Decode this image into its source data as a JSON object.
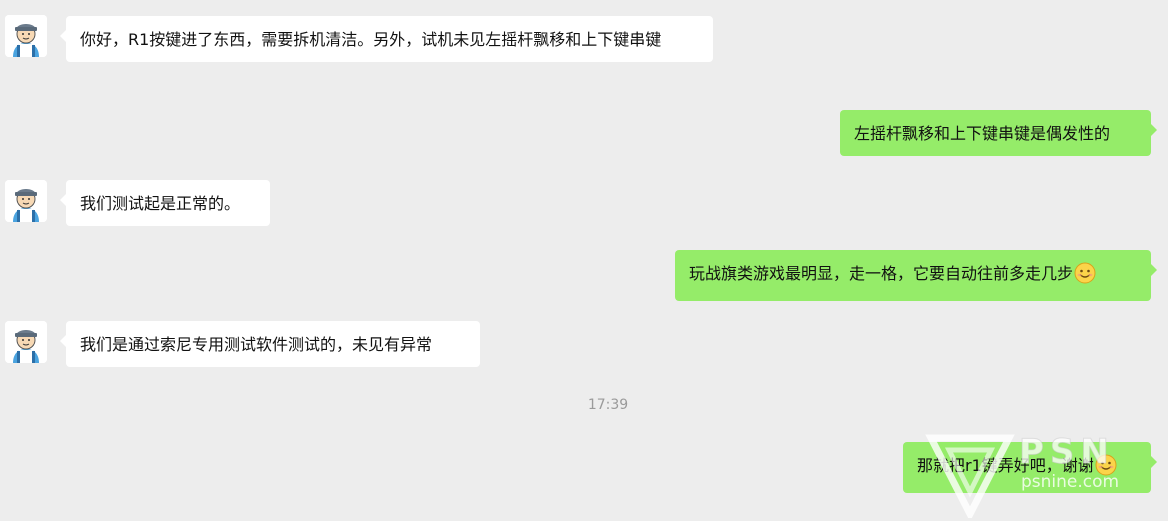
{
  "chat": {
    "messages": [
      {
        "side": "left",
        "text": "你好，R1按键进了东西，需要拆机清洁。另外，试机未见左摇杆飘移和上下键串键"
      },
      {
        "side": "right",
        "text": "左摇杆飘移和上下键串键是偶发性的"
      },
      {
        "side": "left",
        "text": "我们测试起是正常的。"
      },
      {
        "side": "right",
        "text": "玩战旗类游戏最明显，走一格，它要自动往前多走几步",
        "emoji": "smile-emoji"
      },
      {
        "side": "left",
        "text": "我们是通过索尼专用测试软件测试的，未见有异常"
      },
      {
        "side": "right",
        "text": "那就把r1键弄好吧，谢谢",
        "emoji": "smile-emoji"
      }
    ],
    "timestamp": "17:39"
  },
  "watermark": {
    "brand": "PSN",
    "url": "psnine.com"
  },
  "colors": {
    "background": "#ededed",
    "incoming_bubble": "#ffffff",
    "outgoing_bubble": "#95ec69",
    "timestamp_text": "#9a9a9a"
  }
}
